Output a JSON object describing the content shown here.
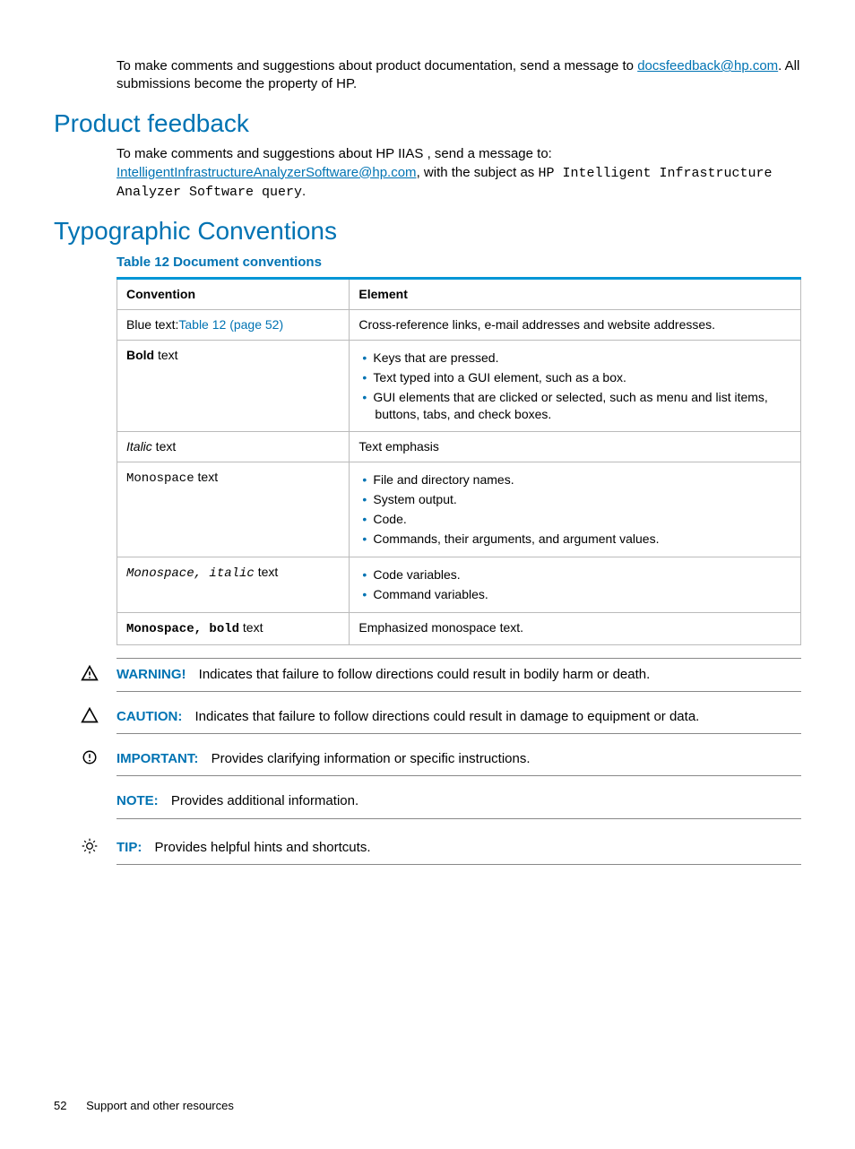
{
  "intro": {
    "p1_a": "To make comments and suggestions about product documentation, send a message to ",
    "email": "docsfeedback@hp.com",
    "p1_b": ". All submissions become the property of HP."
  },
  "section1": {
    "title": "Product feedback",
    "p1_a": "To make comments and suggestions about HP IIAS , send a message to: ",
    "email": "IntelligentInfrastructureAnalyzerSoftware@hp.com",
    "p1_b": ", with the subject as ",
    "mono": "HP Intelligent Infrastructure Analyzer Software query",
    "p1_c": "."
  },
  "section2": {
    "title": "Typographic Conventions",
    "table_title": "Table 12 Document conventions",
    "headers": {
      "c1": "Convention",
      "c2": "Element"
    },
    "rows": {
      "r1": {
        "conv_a": "Blue text:",
        "conv_link": "Table 12 (page 52)",
        "elem": "Cross-reference links, e-mail addresses and website addresses."
      },
      "r2": {
        "conv_bold": "Bold",
        "conv_after": " text",
        "items": {
          "i1": "Keys that are pressed.",
          "i2": "Text typed into a GUI element, such as a box.",
          "i3": "GUI elements that are clicked or selected, such as menu and list items, buttons, tabs, and check boxes."
        }
      },
      "r3": {
        "conv_italic": "Italic",
        "conv_after": " text",
        "elem": "Text emphasis"
      },
      "r4": {
        "conv_mono": "Monospace",
        "conv_after": " text",
        "items": {
          "i1": "File and directory names.",
          "i2": "System output.",
          "i3": "Code.",
          "i4": "Commands, their arguments, and argument values."
        }
      },
      "r5": {
        "conv_mono_italic": "Monospace, italic",
        "conv_after": " text",
        "items": {
          "i1": "Code variables.",
          "i2": "Command variables."
        }
      },
      "r6": {
        "conv_mono_bold": "Monospace, bold",
        "conv_after": " text",
        "elem": "Emphasized monospace text."
      }
    }
  },
  "admons": {
    "warning": {
      "label": "WARNING!",
      "text": "Indicates that failure to follow directions could result in bodily harm or death."
    },
    "caution": {
      "label": "CAUTION:",
      "text": "Indicates that failure to follow directions could result in damage to equipment or data."
    },
    "important": {
      "label": "IMPORTANT:",
      "text": "Provides clarifying information or specific instructions."
    },
    "note": {
      "label": "NOTE:",
      "text": "Provides additional information."
    },
    "tip": {
      "label": "TIP:",
      "text": "Provides helpful hints and shortcuts."
    }
  },
  "footer": {
    "page": "52",
    "section": "Support and other resources"
  }
}
